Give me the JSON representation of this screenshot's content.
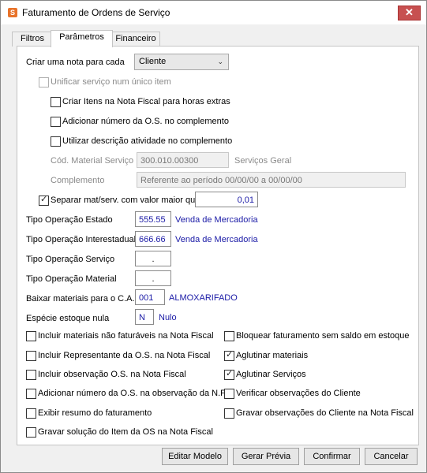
{
  "window": {
    "title": "Faturamento de Ordens de Serviço",
    "close_glyph": "✕"
  },
  "tabs": [
    {
      "label": "Filtros",
      "active": false
    },
    {
      "label": "Parâmetros",
      "active": true
    },
    {
      "label": "Financeiro",
      "active": false
    }
  ],
  "form": {
    "criar_nota_label": "Criar uma nota para cada",
    "criar_nota_value": "Cliente",
    "unificar_label": "Unificar serviço num único item",
    "unificar_checked": false,
    "criar_itens_label": "Criar Itens na Nota Fiscal para horas extras",
    "criar_itens_checked": false,
    "adicionar_num_label": "Adicionar número da O.S. no complemento",
    "adicionar_num_checked": false,
    "utilizar_desc_label": "Utilizar descrição atividade no complemento",
    "utilizar_desc_checked": false,
    "cod_material_label": "Cód. Material Serviço",
    "cod_material_value": "300.010.00300",
    "cod_material_desc": "Serviços Geral",
    "complemento_label": "Complemento",
    "complemento_value": "Referente ao período 00/00/00 a 00/00/00",
    "separar_label": "Separar mat/serv. com valor maior que",
    "separar_checked": true,
    "separar_value": "0,01",
    "tipo_op_estado_label": "Tipo Operação Estado",
    "tipo_op_estado_value": "555.55",
    "tipo_op_estado_desc": "Venda de Mercadoria",
    "tipo_op_inter_label": "Tipo Operação Interestadual",
    "tipo_op_inter_value": "666.66",
    "tipo_op_inter_desc": "Venda de Mercadoria",
    "tipo_op_servico_label": "Tipo Operação Serviço",
    "tipo_op_servico_value": ".",
    "tipo_op_material_label": "Tipo Operação Material",
    "tipo_op_material_value": ".",
    "baixar_label": "Baixar materiais para o C.A.",
    "baixar_value": "001",
    "baixar_desc": "ALMOXARIFADO",
    "especie_label": "Espécie estoque nula",
    "especie_value": "N",
    "especie_desc": "Nulo"
  },
  "options_left": [
    {
      "label": "Incluir materiais não faturáveis na Nota Fiscal",
      "checked": false
    },
    {
      "label": "Incluir Representante da O.S. na Nota Fiscal",
      "checked": false
    },
    {
      "label": "Incluir observação O.S. na Nota Fiscal",
      "checked": false
    },
    {
      "label": "Adicionar número da O.S. na observação da N.F.",
      "checked": false
    },
    {
      "label": "Exibir resumo do faturamento",
      "checked": false
    },
    {
      "label": "Gravar solução do Item da OS na Nota Fiscal",
      "checked": false
    }
  ],
  "options_right": [
    {
      "label": "Bloquear faturamento sem saldo em estoque",
      "checked": false
    },
    {
      "label": "Aglutinar materiais",
      "checked": true
    },
    {
      "label": "Aglutinar Serviços",
      "checked": true
    },
    {
      "label": "Verificar observações do Cliente",
      "checked": false
    },
    {
      "label": "Gravar observações do Cliente na Nota Fiscal",
      "checked": false
    }
  ],
  "buttons": {
    "editar": "Editar Modelo",
    "gerar": "Gerar Prévia",
    "confirmar": "Confirmar",
    "cancelar": "Cancelar"
  },
  "icons": {
    "check": "✓",
    "dropdown": "⌄"
  }
}
